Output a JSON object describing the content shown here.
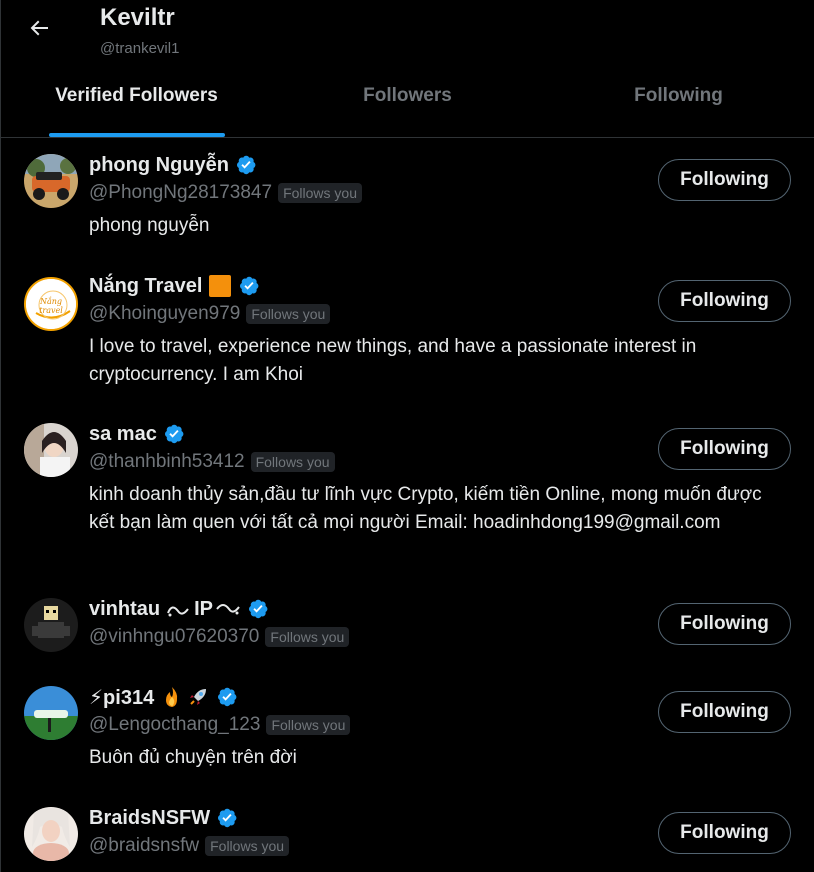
{
  "header": {
    "title": "Keviltr",
    "handle": "@trankevil1"
  },
  "tabs": [
    {
      "label": "Verified Followers",
      "active": true
    },
    {
      "label": "Followers",
      "active": false
    },
    {
      "label": "Following",
      "active": false
    }
  ],
  "users": [
    {
      "name": "phong Nguyễn",
      "handle": "@PhongNg28173847",
      "follows_you": "Follows you",
      "bio": "phong nguyễn",
      "button": "Following"
    },
    {
      "name": "Nắng Travel",
      "handle": "@Khoinguyen979",
      "follows_you": "Follows you",
      "bio": "I love to travel, experience new things, and have a passionate interest in cryptocurrency. I am Khoi",
      "button": "Following",
      "avatar_text": "Nắng travel"
    },
    {
      "name": "sa mac",
      "handle": "@thanhbinh53412",
      "follows_you": "Follows you",
      "bio": "kinh doanh thủy sản,đầu tư lĩnh vực Crypto, kiếm tiền Online, mong muốn được kết bạn làm quen với tất cả mọi người Email: hoadinhdong199@gmail.com",
      "button": "Following"
    },
    {
      "name": "vinhtau",
      "name_suffix": "IP",
      "handle": "@vinhngu07620370",
      "follows_you": "Follows you",
      "bio": "",
      "button": "Following"
    },
    {
      "name": "⚡pi314",
      "handle": "@Lengocthang_123",
      "follows_you": "Follows you",
      "bio": "Buôn đủ chuyện trên đời",
      "button": "Following"
    },
    {
      "name": "BraidsNSFW",
      "handle": "@braidsnsfw",
      "follows_you": "Follows you",
      "bio": "",
      "button": "Following"
    }
  ],
  "colors": {
    "background": "#000000",
    "text": "#e7e9ea",
    "muted": "#71767b",
    "accent": "#1d9bf0",
    "border": "#2f3336",
    "badge_bg": "#202327"
  },
  "icons": {
    "back": "arrow-left-icon",
    "verified": "verified-badge-icon"
  }
}
